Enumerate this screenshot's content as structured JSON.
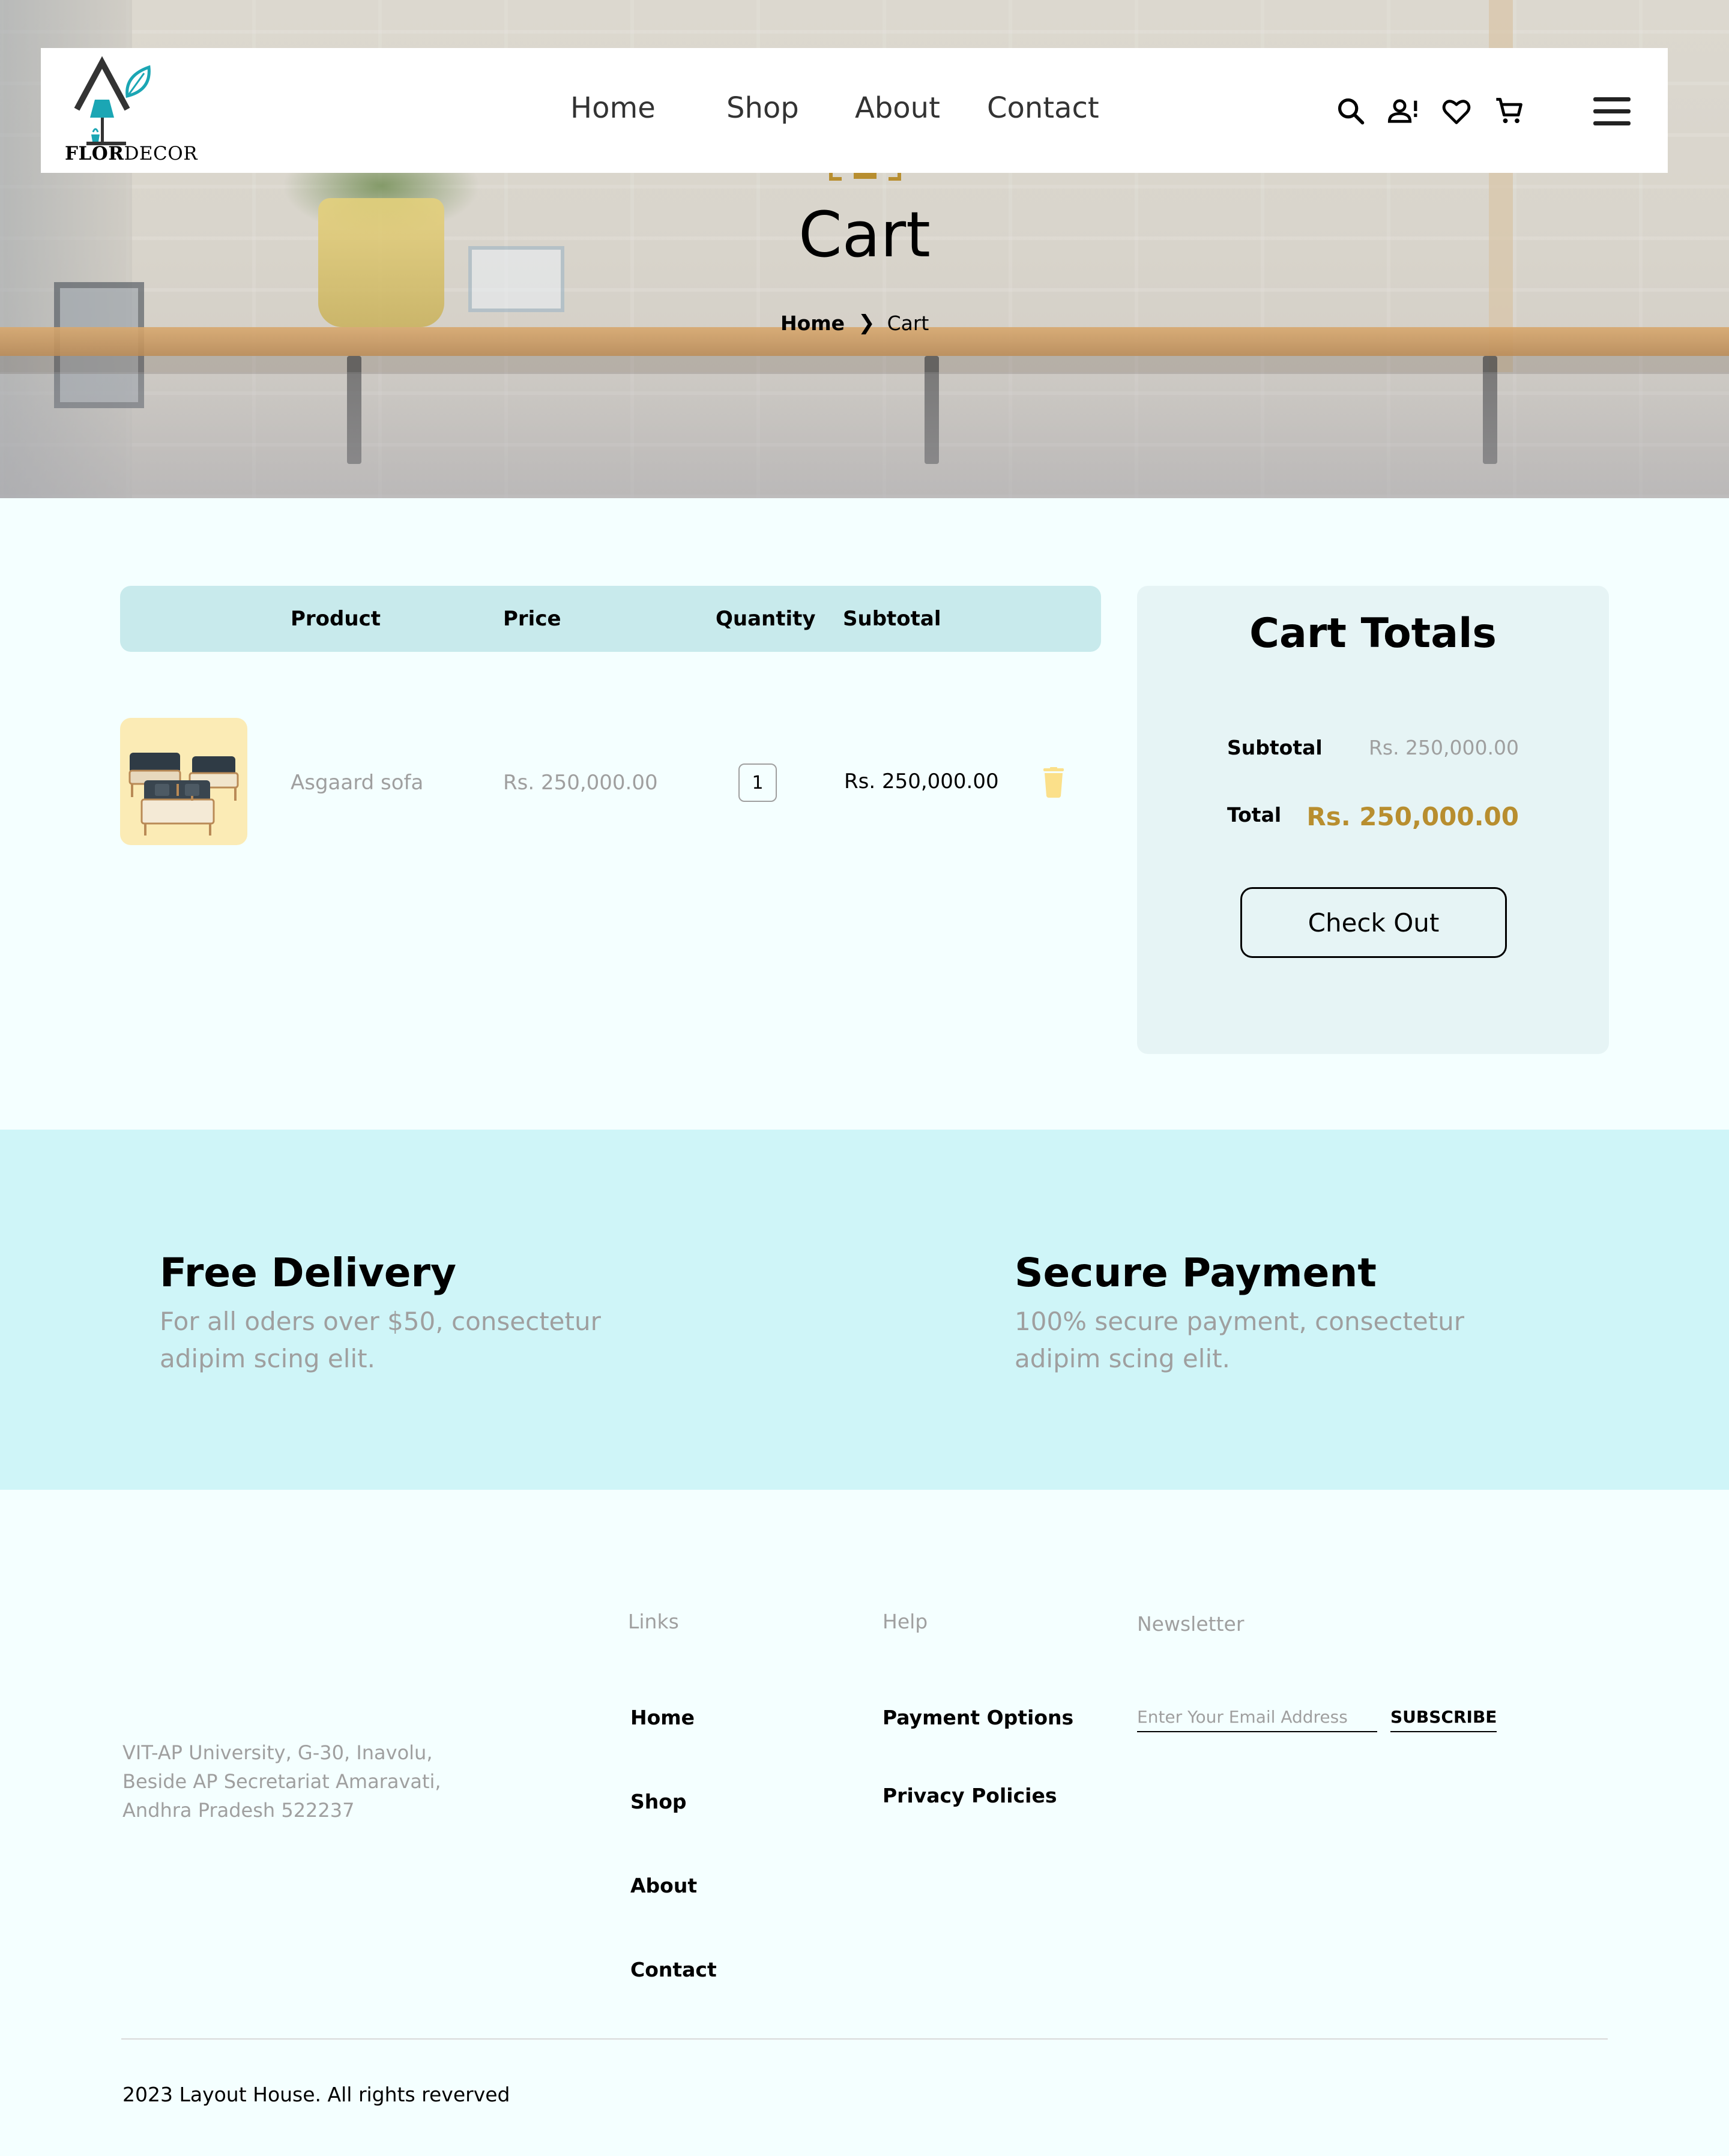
{
  "header": {
    "logo_text_bold": "FLOR",
    "logo_text_rest": "DECOR",
    "nav": [
      "Home",
      "Shop",
      "About",
      "Contact"
    ],
    "icons": [
      "search-icon",
      "account-alert-icon",
      "heart-icon",
      "cart-icon"
    ],
    "menu_icon": "hamburger-menu-icon"
  },
  "hero": {
    "title": "Cart",
    "breadcrumb": {
      "home": "Home",
      "separator": "❯",
      "current": "Cart"
    }
  },
  "cart": {
    "columns": [
      "Product",
      "Price",
      "Quantity",
      "Subtotal"
    ],
    "items": [
      {
        "name": "Asgaard sofa",
        "price": "Rs. 250,000.00",
        "quantity": "1",
        "subtotal": "Rs. 250,000.00"
      }
    ]
  },
  "totals": {
    "title": "Cart Totals",
    "subtotal_label": "Subtotal",
    "subtotal_value": "Rs. 250,000.00",
    "total_label": "Total",
    "total_value": "Rs. 250,000.00",
    "checkout_label": "Check Out"
  },
  "features": [
    {
      "title": "Free Delivery",
      "line1": "For all oders over $50, consectetur",
      "line2": "adipim scing elit."
    },
    {
      "title": "Secure Payment",
      "line1": "100% secure payment, consectetur",
      "line2": "adipim scing elit."
    }
  ],
  "footer": {
    "address": [
      "VIT-AP University, G-30, Inavolu,",
      "Beside AP Secretariat Amaravati,",
      "Andhra Pradesh 522237"
    ],
    "links_heading": "Links",
    "links": [
      "Home",
      "Shop",
      "About",
      "Contact"
    ],
    "help_heading": "Help",
    "help": [
      "Payment Options",
      "Privacy Policies"
    ],
    "newsletter_heading": "Newsletter",
    "newsletter_placeholder": "Enter Your Email Address",
    "subscribe_label": "SUBSCRIBE",
    "copyright": "2023 Layout House. All rights reverved"
  },
  "colors": {
    "accent_gold": "#B88E2F",
    "table_header_bg": "#C8EAEC",
    "totals_bg": "#E6F4F5",
    "features_bg": "#CFF5F8",
    "page_bg": "#F4FFFF",
    "product_bg": "#FBEBB5",
    "muted_text": "#9F9F9F",
    "logo_teal": "#1BA6B4"
  }
}
